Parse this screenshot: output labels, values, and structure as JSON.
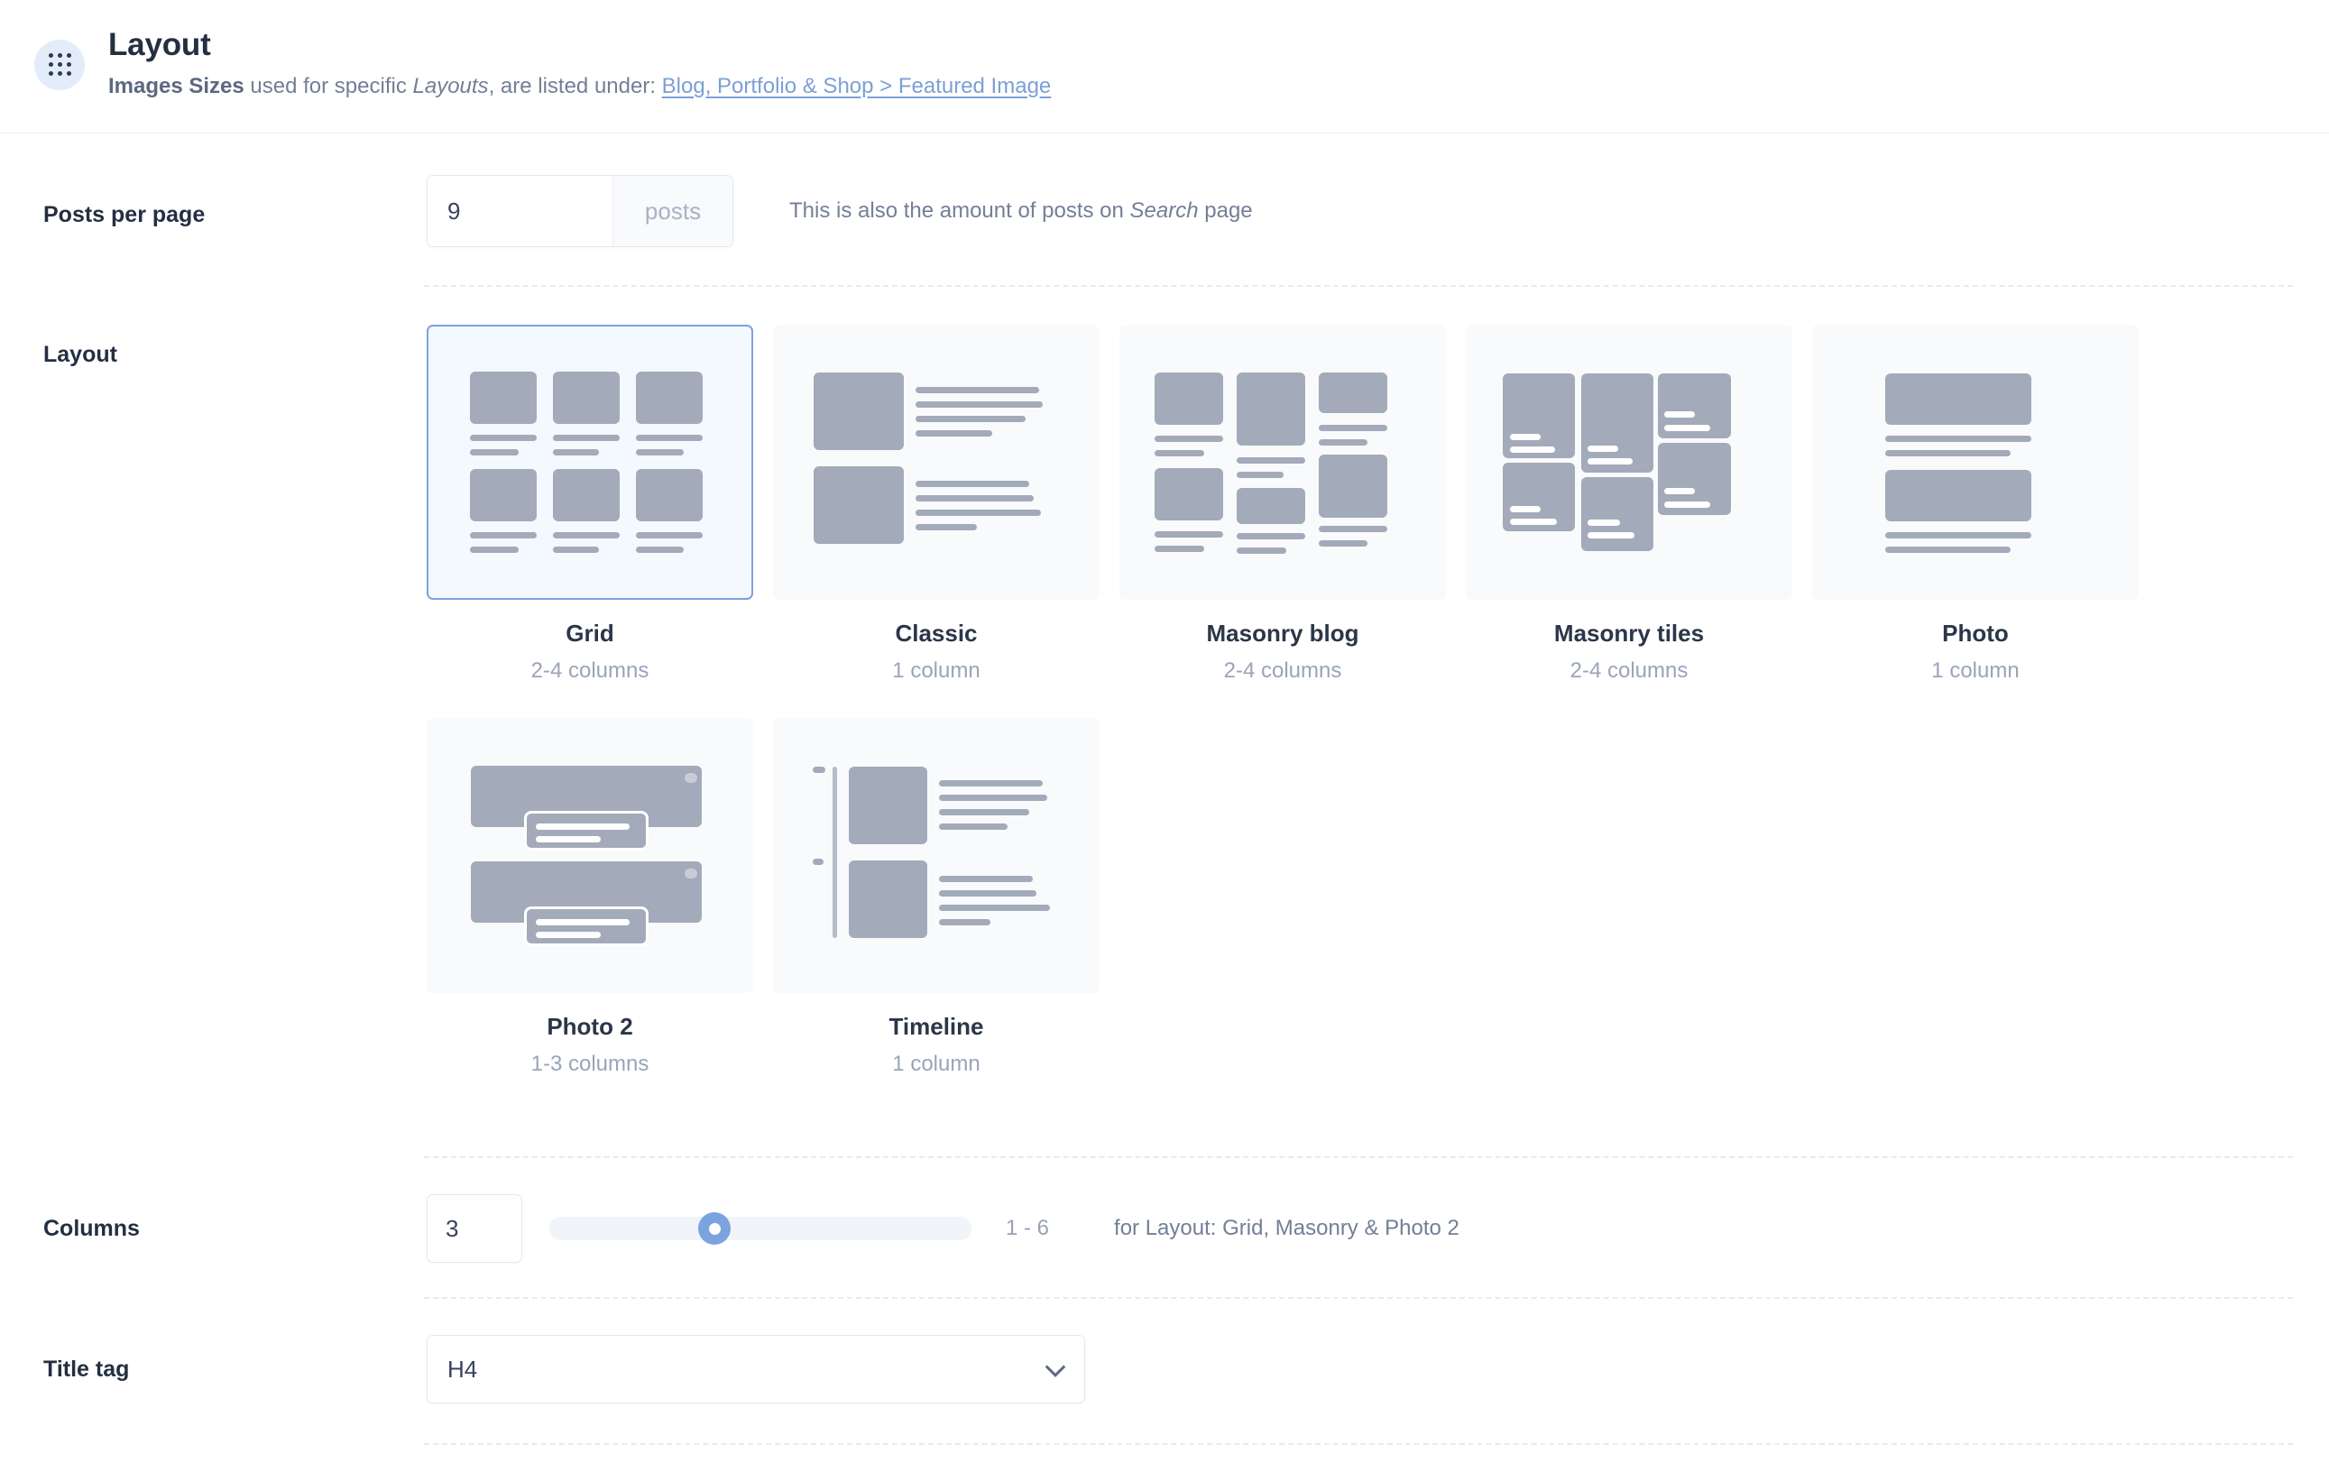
{
  "header": {
    "icon": "drag-handle-dots-icon",
    "title": "Layout",
    "sub_bold": "Images Sizes",
    "sub_mid": " used for specific ",
    "sub_italic": "Layouts",
    "sub_after": ", are listed under: ",
    "link": "Blog, Portfolio & Shop > Featured Image"
  },
  "posts_per_page": {
    "label": "Posts per page",
    "value": "9",
    "placeholder": "9",
    "suffix": "posts",
    "hint_before": "This is also the amount of posts on ",
    "hint_italic": "Search",
    "hint_after": " page"
  },
  "layout": {
    "label": "Layout",
    "selected": "Grid",
    "options": [
      {
        "name": "Grid",
        "columns": "2-4 columns",
        "thumb": "grid",
        "selected": true
      },
      {
        "name": "Classic",
        "columns": "1 column",
        "thumb": "classic",
        "selected": false
      },
      {
        "name": "Masonry blog",
        "columns": "2-4 columns",
        "thumb": "masonry-blog",
        "selected": false
      },
      {
        "name": "Masonry tiles",
        "columns": "2-4 columns",
        "thumb": "masonry-tiles",
        "selected": false
      },
      {
        "name": "Photo",
        "columns": "1 column",
        "thumb": "photo",
        "selected": false
      },
      {
        "name": "Photo 2",
        "columns": "1-3 columns",
        "thumb": "photo-2",
        "selected": false
      },
      {
        "name": "Timeline",
        "columns": "1 column",
        "thumb": "timeline",
        "selected": false
      }
    ]
  },
  "columns": {
    "label": "Columns",
    "value": "3",
    "range": "1 - 6",
    "min": "1",
    "max": "6",
    "hint": "for Layout: Grid, Masonry & Photo 2"
  },
  "title_tag": {
    "label": "Title tag",
    "value": "H4",
    "chevron": "chevron-down-icon"
  },
  "colors": {
    "accent": "#7ba3dd",
    "selected_bg": "#f3f9fe",
    "thumb_bg": "#f8fafc",
    "block": "#a3aab9",
    "text_dark": "#242f41",
    "text_muted": "#737f96",
    "link": "#7c9fd6"
  }
}
